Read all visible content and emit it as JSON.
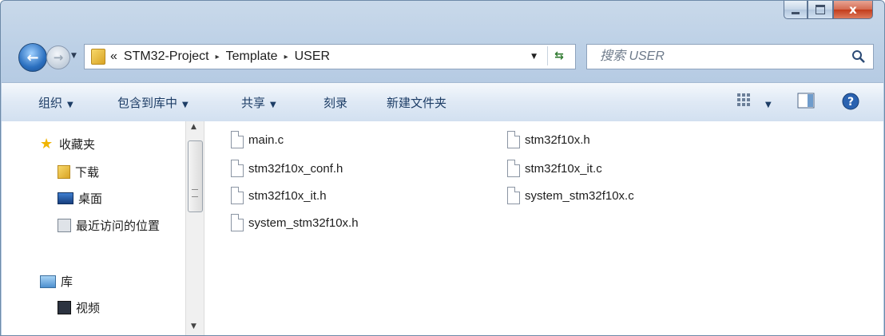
{
  "window": {
    "caption_buttons": {
      "minimize": "–",
      "maximize": "□",
      "close": "x"
    }
  },
  "address_bar": {
    "overflow": "«",
    "crumbs": [
      "STM32-Project",
      "Template",
      "USER"
    ],
    "separator": "▸"
  },
  "search": {
    "placeholder": "搜索 USER"
  },
  "toolbar": {
    "organize": "组织",
    "include_in_library": "包含到库中",
    "share": "共享",
    "burn": "刻录",
    "new_folder": "新建文件夹"
  },
  "nav_pane": {
    "favorites": "收藏夹",
    "downloads": "下载",
    "desktop": "桌面",
    "recent": "最近访问的位置",
    "libraries": "库",
    "videos": "视频"
  },
  "files": [
    "main.c",
    "stm32f10x_conf.h",
    "stm32f10x_it.h",
    "system_stm32f10x.h",
    "stm32f10x.h",
    "stm32f10x_it.c",
    "system_stm32f10x.c"
  ],
  "icons": {
    "back": "back-arrow-icon",
    "forward": "forward-arrow-icon",
    "search": "magnifier-icon",
    "views": "views-grid-icon",
    "preview": "preview-pane-icon",
    "help": "help-icon",
    "file": "document-icon"
  },
  "colors": {
    "toolbar_text": "#1d3d66",
    "accent": "#2a6fbf",
    "close": "#c23c1b"
  }
}
